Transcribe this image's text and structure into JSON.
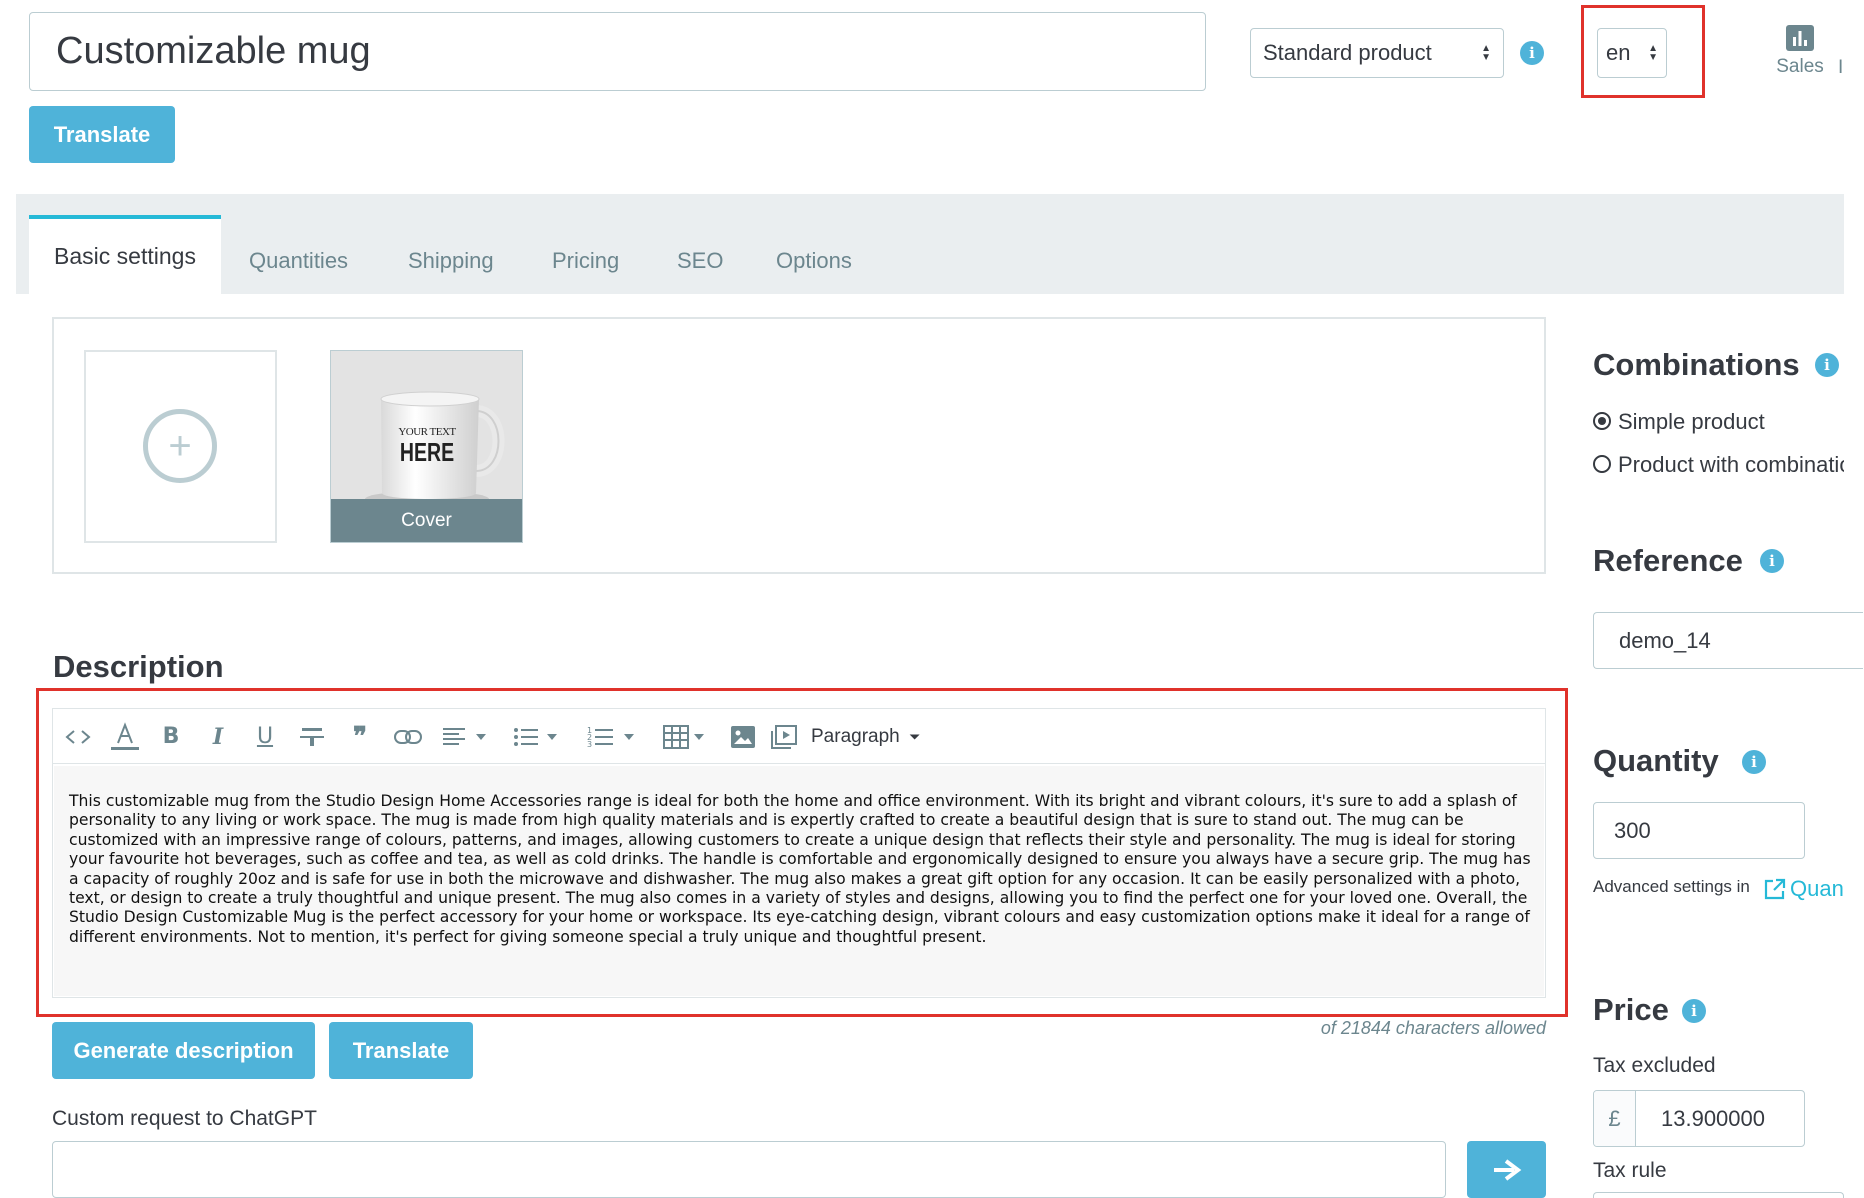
{
  "header": {
    "product_name": "Customizable mug",
    "translate_label": "Translate",
    "product_type": "Standard product",
    "language": "en",
    "sales_label": "Sales",
    "cutoff_label": "I"
  },
  "tabs": [
    {
      "label": "Basic settings"
    },
    {
      "label": "Quantities"
    },
    {
      "label": "Shipping"
    },
    {
      "label": "Pricing"
    },
    {
      "label": "SEO"
    },
    {
      "label": "Options"
    }
  ],
  "images": {
    "cover_label": "Cover",
    "mug_text_small": "YOUR TEXT",
    "mug_text_large": "HERE"
  },
  "description": {
    "title": "Description",
    "format_select": "Paragraph",
    "text": "This customizable mug from the Studio Design Home Accessories range is ideal for both the home and office environment. With its bright and vibrant colours, it's sure to add a splash of personality to any living or work space. The mug is made from high quality materials and is expertly crafted to create a beautiful design that is sure to stand out. The mug can be customized with an impressive range of colours, patterns, and images, allowing customers to create a unique design that reflects their style and personality. The mug is ideal for storing your favourite hot beverages, such as coffee and tea, as well as cold drinks. The handle is comfortable and ergonomically designed to ensure you always have a secure grip. The mug has a capacity of roughly 20oz and is safe for use in both the microwave and dishwasher. The mug also makes a great gift option for any occasion. It can be easily personalized with a photo, text, or design to create a truly thoughtful and unique present. The mug also comes in a variety of styles and designs, allowing you to find the perfect one for your loved one. Overall, the Studio Design Customizable Mug is the perfect accessory for your home or workspace. Its eye-catching design, vibrant colours and easy customization options make it ideal for a range of different environments. Not to mention, it's perfect for giving someone special a truly unique and thoughtful present.",
    "char_limit": "of 21844 characters allowed",
    "generate_label": "Generate description",
    "translate_label": "Translate",
    "custom_request_label": "Custom request to ChatGPT",
    "custom_request_value": ""
  },
  "right": {
    "combinations_title": "Combinations",
    "simple_product": "Simple product",
    "with_combinations": "Product with combinations",
    "reference_title": "Reference",
    "reference_value": "demo_14",
    "quantity_title": "Quantity",
    "quantity_value": "300",
    "advanced_settings": "Advanced settings in",
    "quantities_link": "Quantities",
    "price_title": "Price",
    "tax_excluded": "Tax excluded",
    "currency": "£",
    "price_value": "13.900000",
    "tax_rule": "Tax rule"
  },
  "colors": {
    "accent": "#4fb3d9",
    "highlight": "#e0322b"
  }
}
